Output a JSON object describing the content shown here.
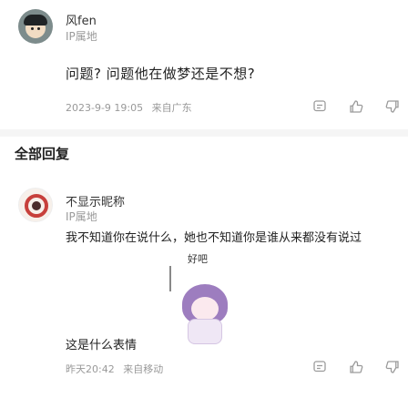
{
  "post": {
    "author": "风fen",
    "ip_tag": "IP属地",
    "question": "问题? 问题他在做梦还是不想?",
    "date": "2023-9-9 19:05",
    "reply_label": "来自广东"
  },
  "section": {
    "title": "全部回复"
  },
  "reply": {
    "author": "不显示昵称",
    "ip_tag": "IP属地",
    "text": "我不知道你在说什么，她也不知道你是谁从来都没有说过",
    "sticker_caption": "好吧",
    "tail": "这是什么表情",
    "time": "昨天20:42",
    "reply_label": "来自移动"
  },
  "icons": {
    "reply": "comment-icon",
    "like": "thumbs-up-icon",
    "dislike": "thumbs-down-icon"
  }
}
